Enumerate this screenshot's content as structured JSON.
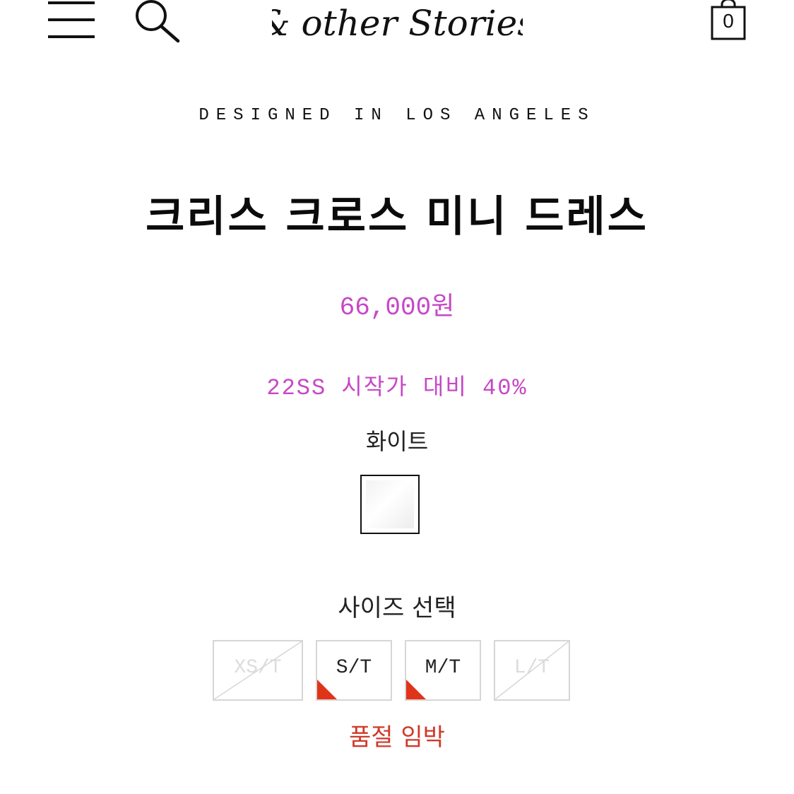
{
  "header": {
    "brand": "& other Stories",
    "menu_icon": "menu-icon",
    "search_icon": "search-icon",
    "cart_icon": "shopping-bag-icon",
    "cart_count": "0"
  },
  "product": {
    "designed_in": "DESIGNED IN LOS ANGELES",
    "title": "크리스 크로스 미니 드레스",
    "price": "66,000원",
    "promo": "22SS 시작가 대비 40%",
    "color_name": "화이트",
    "swatch_color": "#f4f4f4",
    "accent_color": "#c648c6"
  },
  "sizes": {
    "title": "사이즈 선택",
    "options": [
      {
        "label": "XS/T",
        "available": false,
        "low_stock": false
      },
      {
        "label": "S/T",
        "available": true,
        "low_stock": true
      },
      {
        "label": "M/T",
        "available": true,
        "low_stock": true
      },
      {
        "label": "L/T",
        "available": false,
        "low_stock": false
      }
    ],
    "low_stock_text": "품절 임박",
    "low_stock_color": "#e0341a"
  }
}
